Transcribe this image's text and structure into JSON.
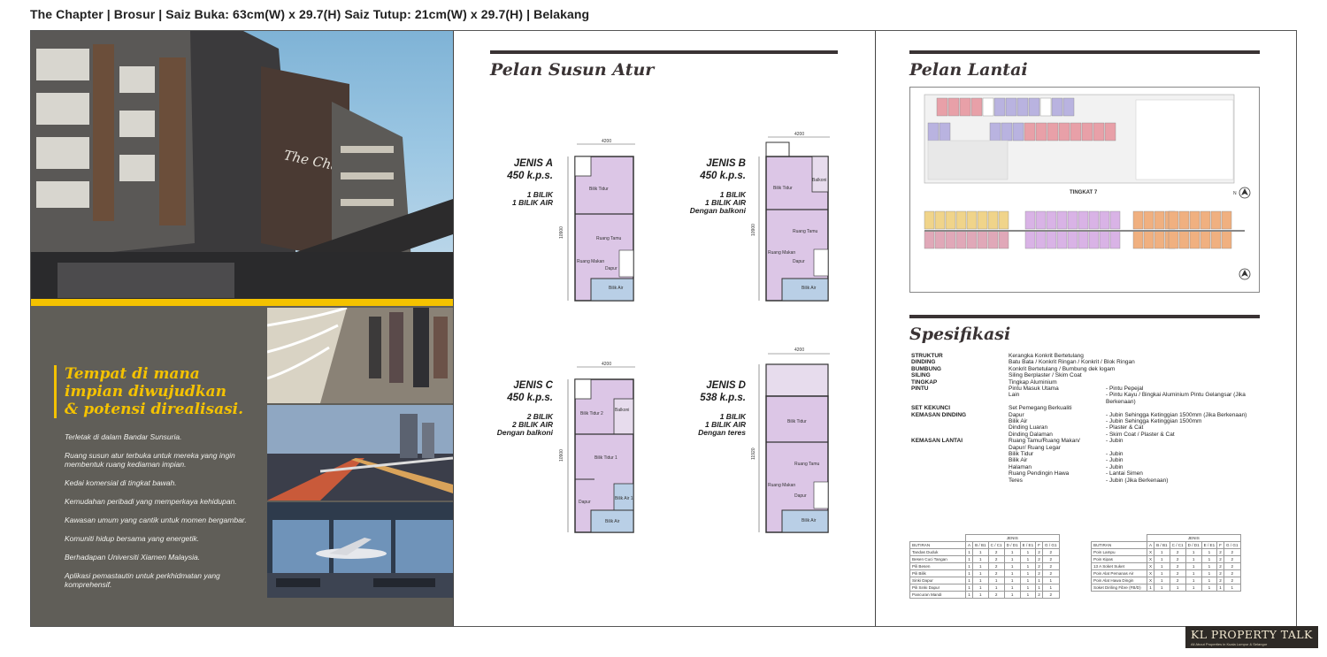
{
  "header": {
    "title": "The Chapter | Brosur | Saiz Buka: 63cm(W) x 29.7(H) Saiz Tutup: 21cm(W) x 29.7(H) | Belakang"
  },
  "left": {
    "building_sign": "The Chapter",
    "tagline": [
      "Tempat di mana",
      "impian diwujudkan",
      "& potensi direalisasi."
    ],
    "features": [
      "Terletak di dalam Bandar Sunsuria.",
      "Ruang susun atur terbuka untuk mereka yang ingin membentuk ruang kediaman impian.",
      "Kedai komersial di tingkat bawah.",
      "Kemudahan peribadi yang memperkaya kehidupan.",
      "Kawasan umum yang cantik untuk momen bergambar.",
      "Komuniti hidup bersama yang energetik.",
      "Berhadapan Universiti Xiamen Malaysia.",
      "Aplikasi pemastautin untuk perkhidmatan yang komprehensif."
    ]
  },
  "middle": {
    "heading": "Pelan Susun Atur",
    "plans": [
      {
        "type": "JENIS A",
        "size": "450 k.p.s.",
        "desc": [
          "1 BILIK",
          "1 BILIK AIR"
        ],
        "rooms": [
          "Bilik Tidur",
          "Ruang Tamu",
          "Ruang Makan",
          "Dapur",
          "Bilik Air"
        ],
        "dim_w": "4200",
        "dim_h": "10900"
      },
      {
        "type": "JENIS B",
        "size": "450 k.p.s.",
        "desc": [
          "1 BILIK",
          "1 BILIK AIR",
          "Dengan balkoni"
        ],
        "rooms": [
          "Bilik Tidur",
          "Balkoni",
          "Ruang Tamu",
          "Ruang Makan",
          "Dapur",
          "Bilik Air"
        ],
        "dim_w": "4200",
        "dim_h": "10900"
      },
      {
        "type": "JENIS C",
        "size": "450 k.p.s.",
        "desc": [
          "2 BILIK",
          "2 BILIK AIR",
          "Dengan balkoni"
        ],
        "rooms": [
          "Bilik Tidur 2",
          "Balkoni",
          "Bilik Tidur 1",
          "Dapur",
          "Bilik Air 1",
          "Bilik Air"
        ],
        "dim_w": "4200",
        "dim_h": "10900"
      },
      {
        "type": "JENIS D",
        "size": "538 k.p.s.",
        "desc": [
          "1 BILIK",
          "1 BILIK AIR",
          "Dengan teres"
        ],
        "rooms": [
          "Bilik Tidur",
          "Ruang Tamu",
          "Ruang Makan",
          "Dapur",
          "Bilik Air"
        ],
        "dim_w": "4200",
        "dim_h": "11920"
      }
    ]
  },
  "right": {
    "floor_heading": "Pelan Lantai",
    "floor_label": "TINGKAT 7",
    "north_label": "N",
    "spec_heading": "Spesifikasi",
    "specs": [
      {
        "k": "STRUKTUR",
        "v": "Kerangka Konkrit Bertetulang"
      },
      {
        "k": "DINDING",
        "v": "Batu Bata / Konkrit Ringan / Konkrit / Blok Ringan"
      },
      {
        "k": "BUMBUNG",
        "v": "Konkrit Bertetulang / Bumbung dek logam"
      },
      {
        "k": "SILING",
        "v": "Siling Berplaster / Skim Coat"
      },
      {
        "k": "TINGKAP",
        "v": "Tingkap Aluminium"
      },
      {
        "k": "PINTU",
        "v": "Pintu Masuk Utama",
        "w": "- Pintu Pepejal"
      },
      {
        "k": "",
        "v": "Lain",
        "w": "- Pintu Kayu / Bingkai Aluminium Pintu Gelangsar (Jika Berkenaan)"
      },
      {
        "k": "",
        "v": ""
      },
      {
        "k": "SET KEKUNCI",
        "v": "Set Pemegang Berkualiti"
      },
      {
        "k": "KEMASAN DINDING",
        "v": "Dapur",
        "w": "- Jubin Sehingga Ketinggian 1500mm (Jika Berkenaan)"
      },
      {
        "k": "",
        "v": "Bilik Air",
        "w": "- Jubin Sehingga Ketinggian 1500mm"
      },
      {
        "k": "",
        "v": "Dinding Luaran",
        "w": "- Plaster & Cat"
      },
      {
        "k": "",
        "v": "Dinding Dalaman",
        "w": "- Skim Coat / Plaster & Cat"
      },
      {
        "k": "KEMASAN LANTAI",
        "v": "Ruang Tamu/Ruang Makan/",
        "w": "- Jubin"
      },
      {
        "k": "",
        "v": "Dapur/ Ruang Legar"
      },
      {
        "k": "",
        "v": "Bilik Tidur",
        "w": "- Jubin"
      },
      {
        "k": "",
        "v": "Bilik Air",
        "w": "- Jubin"
      },
      {
        "k": "",
        "v": "Halaman",
        "w": "- Jubin"
      },
      {
        "k": "",
        "v": "Ruang Pendingin Hawa",
        "w": "- Lantai Simen"
      },
      {
        "k": "",
        "v": "Teres",
        "w": "- Jubin (Jika Berkenaan)"
      }
    ],
    "table_header": "JENIS",
    "table_cols": [
      "A",
      "B / B1",
      "C / C1",
      "D / D1",
      "E / E1",
      "F",
      "G / G1"
    ],
    "table_left_title": "BUTIRAN",
    "table_left": [
      {
        "name": "Tandas Duduk",
        "vals": [
          "1",
          "1",
          "2",
          "1",
          "1",
          "2",
          "2"
        ]
      },
      {
        "name": "Besen Cuci Tangan",
        "vals": [
          "1",
          "1",
          "2",
          "1",
          "1",
          "2",
          "2"
        ]
      },
      {
        "name": "Pili Besen",
        "vals": [
          "1",
          "1",
          "2",
          "1",
          "1",
          "2",
          "2"
        ]
      },
      {
        "name": "Pili Bilik",
        "vals": [
          "1",
          "1",
          "2",
          "1",
          "1",
          "2",
          "2"
        ]
      },
      {
        "name": "Sinki Dapur",
        "vals": [
          "1",
          "1",
          "1",
          "1",
          "1",
          "1",
          "1"
        ]
      },
      {
        "name": "Pili Sinki Dapur",
        "vals": [
          "1",
          "1",
          "1",
          "1",
          "1",
          "1",
          "1"
        ]
      },
      {
        "name": "Pancuran Mandi",
        "vals": [
          "1",
          "1",
          "2",
          "1",
          "1",
          "2",
          "2"
        ]
      }
    ],
    "table_right_title": "BUTIRAN",
    "table_right": [
      {
        "name": "Poin Lampu",
        "vals": [
          "X",
          "1",
          "2",
          "1",
          "1",
          "2",
          "2"
        ]
      },
      {
        "name": "Poin Kipas",
        "vals": [
          "X",
          "1",
          "2",
          "1",
          "1",
          "2",
          "2"
        ]
      },
      {
        "name": "13 A Soket Suket",
        "vals": [
          "X",
          "1",
          "2",
          "1",
          "1",
          "2",
          "2"
        ]
      },
      {
        "name": "Poin Alat Pemanas Air",
        "vals": [
          "X",
          "1",
          "2",
          "1",
          "1",
          "2",
          "2"
        ]
      },
      {
        "name": "Poin Alat Hawa Dingin",
        "vals": [
          "X",
          "1",
          "2",
          "1",
          "1",
          "2",
          "2"
        ]
      },
      {
        "name": "Soket Diriling Fibre (FB/D)",
        "vals": [
          "1",
          "1",
          "1",
          "1",
          "1",
          "1",
          "1"
        ]
      }
    ]
  },
  "watermark": {
    "brand": "KL PROPERTY TALK",
    "sub": "All About Properties in Kuala Lumpur & Selangor"
  },
  "colors": {
    "gold": "#f4c200",
    "panel_grey": "#605e58",
    "heading": "#3a3334",
    "room_fill": "#d9c4e4"
  }
}
